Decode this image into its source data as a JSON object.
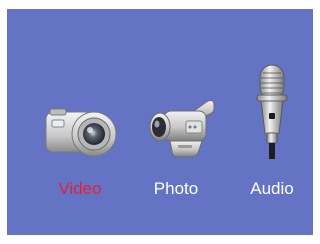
{
  "menu": {
    "selected": "video",
    "items": [
      {
        "id": "video",
        "label": "Video",
        "icon": "digital-camera-icon"
      },
      {
        "id": "photo",
        "label": "Photo",
        "icon": "camcorder-icon"
      },
      {
        "id": "audio",
        "label": "Audio",
        "icon": "microphone-icon"
      }
    ]
  },
  "colors": {
    "background": "#6473c4",
    "label": "#ffffff",
    "selected_label": "#e0203e"
  }
}
